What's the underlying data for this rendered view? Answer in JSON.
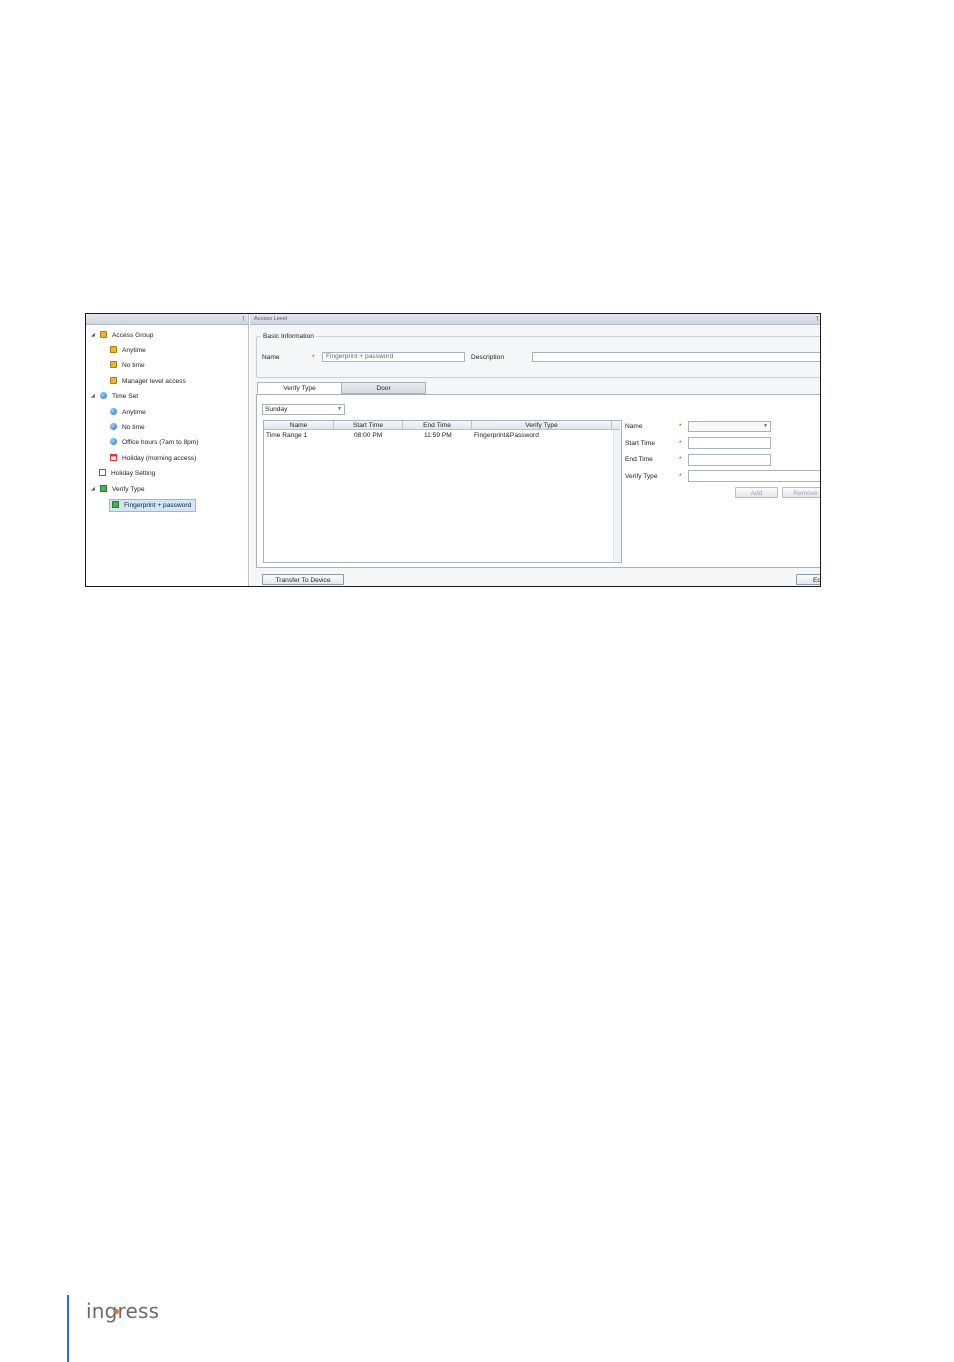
{
  "tree": {
    "items": [
      {
        "label": "Access Group",
        "icon": "lock-icon",
        "expander": "◢"
      },
      {
        "label": "Anytime",
        "icon": "lock-icon"
      },
      {
        "label": "No time",
        "icon": "lock-icon"
      },
      {
        "label": "Manager level access",
        "icon": "lock-icon"
      },
      {
        "label": "Time Set",
        "icon": "globe-icon",
        "expander": "◢"
      },
      {
        "label": "Anytime",
        "icon": "globe-icon"
      },
      {
        "label": "No time",
        "icon": "globe-icon"
      },
      {
        "label": "Office hours (7am to 8pm)",
        "icon": "globe-icon"
      },
      {
        "label": "Holiday (morning access)",
        "icon": "calendar-icon"
      },
      {
        "label": "Holiday Setting",
        "icon": "calendar-icon"
      },
      {
        "label": "Verify Type",
        "icon": "check-icon",
        "expander": "◢"
      },
      {
        "label": "Fingerprint + password",
        "icon": "check-icon",
        "selected": true
      }
    ],
    "pin_glyph": "⊺"
  },
  "main": {
    "title": "Access Level",
    "pin_glyph": "⊺",
    "basic_info": {
      "legend": "Basic Information",
      "name_label": "Name",
      "required": "*",
      "name_value": "Fingerprint + password",
      "description_label": "Description",
      "description_value": ""
    },
    "tabs": [
      {
        "label": "Verify Type",
        "active": true
      },
      {
        "label": "Door",
        "active": false
      }
    ],
    "day_select": "Sunday",
    "grid": {
      "columns": [
        "Name",
        "Start Time",
        "End Time",
        "Verify Type"
      ],
      "rows": [
        {
          "name": "Time Range 1",
          "start": "08:00 PM",
          "end": "11:59 PM",
          "verify": "Fingerprint&Password"
        }
      ]
    },
    "form": {
      "name_label": "Name",
      "start_label": "Start Time",
      "end_label": "End Time",
      "verify_label": "Verify Type",
      "required": "*",
      "add_button": "Add",
      "remove_button": "Remove"
    },
    "footer": {
      "transfer_button": "Transfer To Device",
      "edit_button": "Ed"
    }
  },
  "branding": {
    "logo_text": "ingress",
    "accent": "#2f6fb5",
    "dot_color": "#e0762b"
  }
}
